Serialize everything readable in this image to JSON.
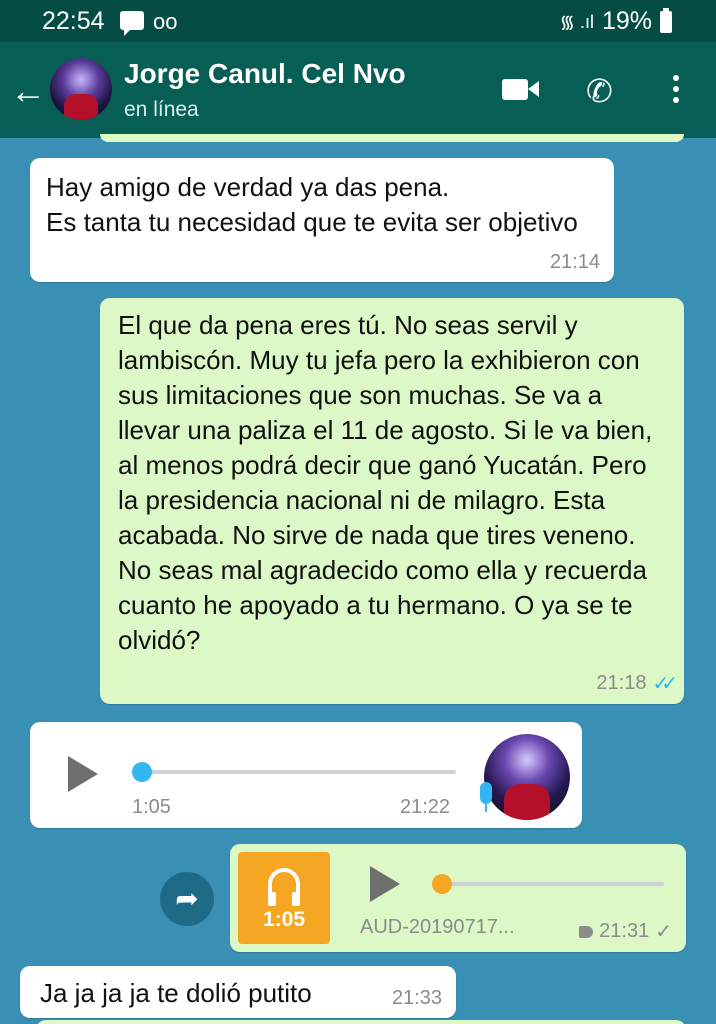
{
  "status_bar": {
    "time": "22:54",
    "battery": "19%"
  },
  "header": {
    "contact_name": "Jorge Canul. Cel Nvo",
    "contact_status": "en línea"
  },
  "messages": [
    {
      "direction": "in",
      "text": "Hay amigo de verdad ya das pena.\nEs tanta tu necesidad que te evita ser objetivo",
      "time": "21:14"
    },
    {
      "direction": "out",
      "text": "El que da pena eres tú. No seas servil y lambiscón. Muy tu jefa pero la exhibieron con sus limitaciones que son muchas. Se va a llevar una paliza el 11 de agosto. Si le va bien, al menos podrá decir que ganó Yucatán. Pero la presidencia nacional ni de milagro. Esta acabada. No sirve de nada que tires veneno. No seas mal agradecido como ella y recuerda cuanto he apoyado a tu hermano. O ya se te olvidó?",
      "time": "21:18",
      "ticks": "✓✓"
    },
    {
      "direction": "in",
      "type": "voice",
      "duration": "1:05",
      "time": "21:22",
      "progress": 0
    },
    {
      "direction": "out",
      "type": "audio-file",
      "duration": "1:05",
      "filename": "AUD-20190717...",
      "time": "21:31",
      "ticks": "✓",
      "progress": 0
    },
    {
      "direction": "in",
      "text": "Ja ja ja ja te dolió putito",
      "time": "21:33"
    }
  ],
  "icons": {
    "back": "←",
    "call": "✆",
    "forward": "➦",
    "voicemail": "oo",
    "signal": "᯾ .ıl"
  }
}
